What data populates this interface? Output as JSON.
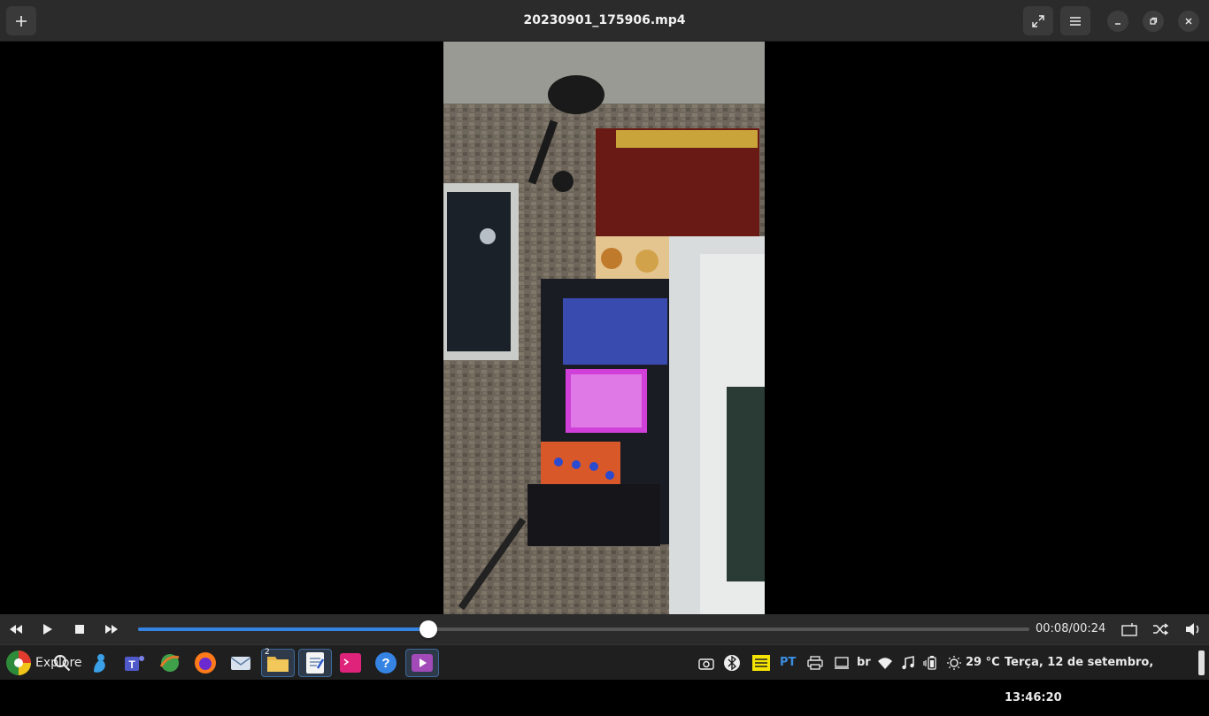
{
  "window": {
    "title": "20230901_175906.mp4"
  },
  "player": {
    "progress_fraction": 0.326,
    "time_display": "00:08/00:24"
  },
  "taskbar": {
    "explore_label": "Explore",
    "files_badge": "2",
    "keyboard_layout": "PT",
    "language": "br",
    "temperature": "29 °C",
    "clock": "Terça, 12 de setembro, 13:46:20"
  },
  "colors": {
    "accent": "#3584e4",
    "headerbar": "#2b2b2b",
    "taskbar": "#1f1f1f"
  }
}
